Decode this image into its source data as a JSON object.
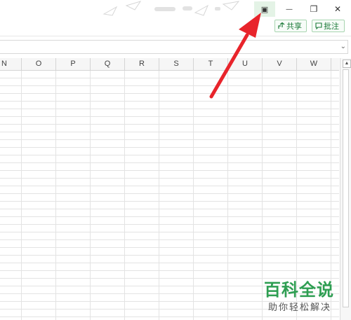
{
  "titlebar": {
    "buttons": [
      {
        "name": "window-mode-button",
        "icon": "window-mode-icon",
        "glyph": "▣"
      },
      {
        "name": "minimize-button",
        "icon": "minimize-icon",
        "glyph": "—"
      },
      {
        "name": "restore-button",
        "icon": "restore-icon",
        "glyph": "❐"
      },
      {
        "name": "close-button",
        "icon": "close-icon",
        "glyph": "✕"
      }
    ]
  },
  "ribbon": {
    "share_label": "共享",
    "comment_label": "批注"
  },
  "grid": {
    "columns": [
      "N",
      "O",
      "P",
      "Q",
      "R",
      "S",
      "T",
      "U",
      "V",
      "W"
    ]
  },
  "watermark": {
    "title": "百科全说",
    "subtitle": "助你轻松解决"
  },
  "colors": {
    "accent": "#1b7a38",
    "arrow": "#e8242b",
    "watermark": "#2e9e52"
  }
}
